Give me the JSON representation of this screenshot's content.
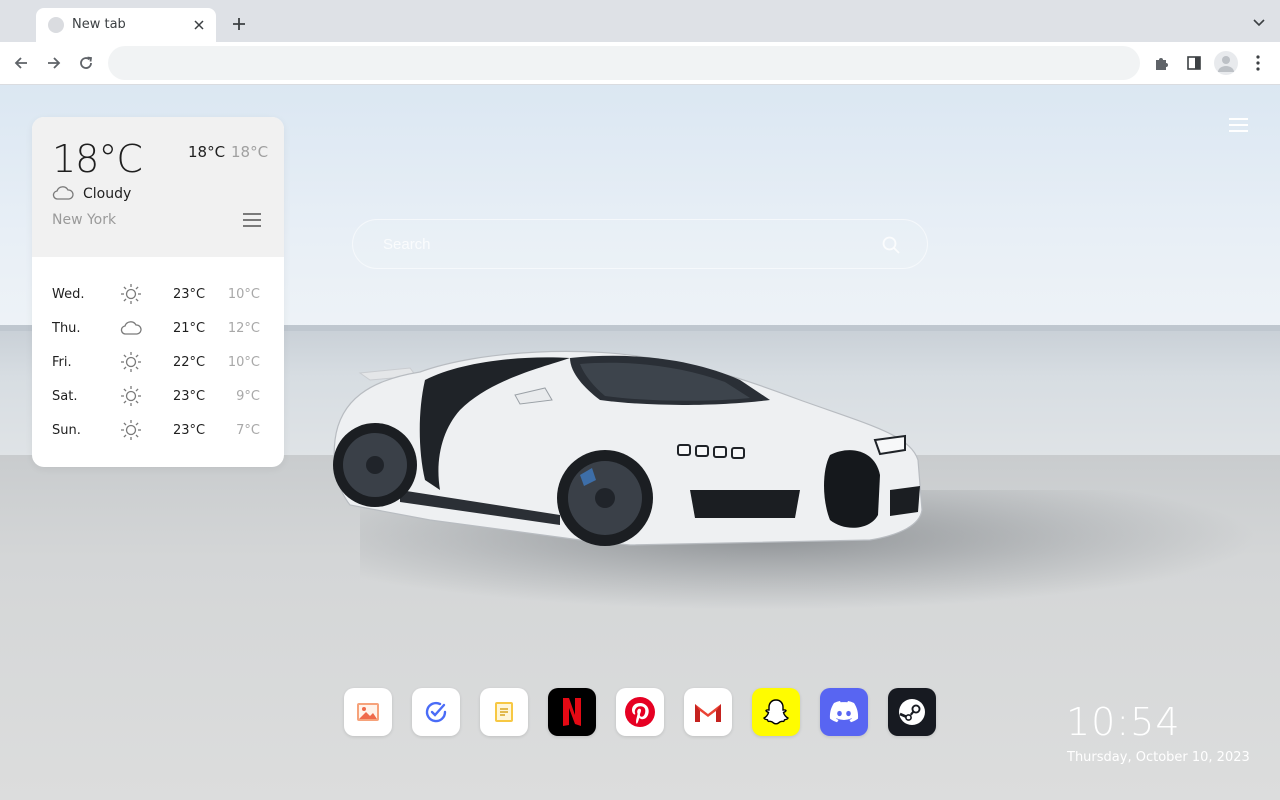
{
  "browser": {
    "tab_title": "New tab",
    "address_value": "",
    "address_placeholder": ""
  },
  "weather": {
    "current_temp": "18°C",
    "today_high": "18°C",
    "today_low": "18°C",
    "condition": "Cloudy",
    "city": "New York",
    "forecast": [
      {
        "day": "Wed.",
        "icon": "sun-icon",
        "high": "23°C",
        "low": "10°C"
      },
      {
        "day": "Thu.",
        "icon": "cloud-icon",
        "high": "21°C",
        "low": "12°C"
      },
      {
        "day": "Fri.",
        "icon": "sun-icon",
        "high": "22°C",
        "low": "10°C"
      },
      {
        "day": "Sat.",
        "icon": "sun-icon",
        "high": "23°C",
        "low": "9°C"
      },
      {
        "day": "Sun.",
        "icon": "sun-icon",
        "high": "23°C",
        "low": "7°C"
      }
    ]
  },
  "search": {
    "placeholder": "Search"
  },
  "dock": {
    "apps": [
      {
        "name": "photos",
        "icon": "image-icon",
        "bg": "#ffffff"
      },
      {
        "name": "tasks",
        "icon": "check-circle-icon",
        "bg": "#ffffff"
      },
      {
        "name": "notes",
        "icon": "note-icon",
        "bg": "#ffffff"
      },
      {
        "name": "netflix",
        "icon": "netflix-icon",
        "bg": "#000000"
      },
      {
        "name": "pinterest",
        "icon": "pinterest-icon",
        "bg": "#ffffff"
      },
      {
        "name": "gmail",
        "icon": "gmail-icon",
        "bg": "#ffffff"
      },
      {
        "name": "snapchat",
        "icon": "snapchat-icon",
        "bg": "#fffc00"
      },
      {
        "name": "discord",
        "icon": "discord-icon",
        "bg": "#5865f2"
      },
      {
        "name": "steam",
        "icon": "steam-icon",
        "bg": "#171a21"
      }
    ]
  },
  "clock": {
    "time": "10:54",
    "date": "Thursday, October 10, 2023"
  },
  "colors": {
    "netflix_red": "#e50914",
    "pinterest_red": "#e60023",
    "discord_blue": "#5865f2",
    "snapchat_yellow": "#fffc00"
  }
}
